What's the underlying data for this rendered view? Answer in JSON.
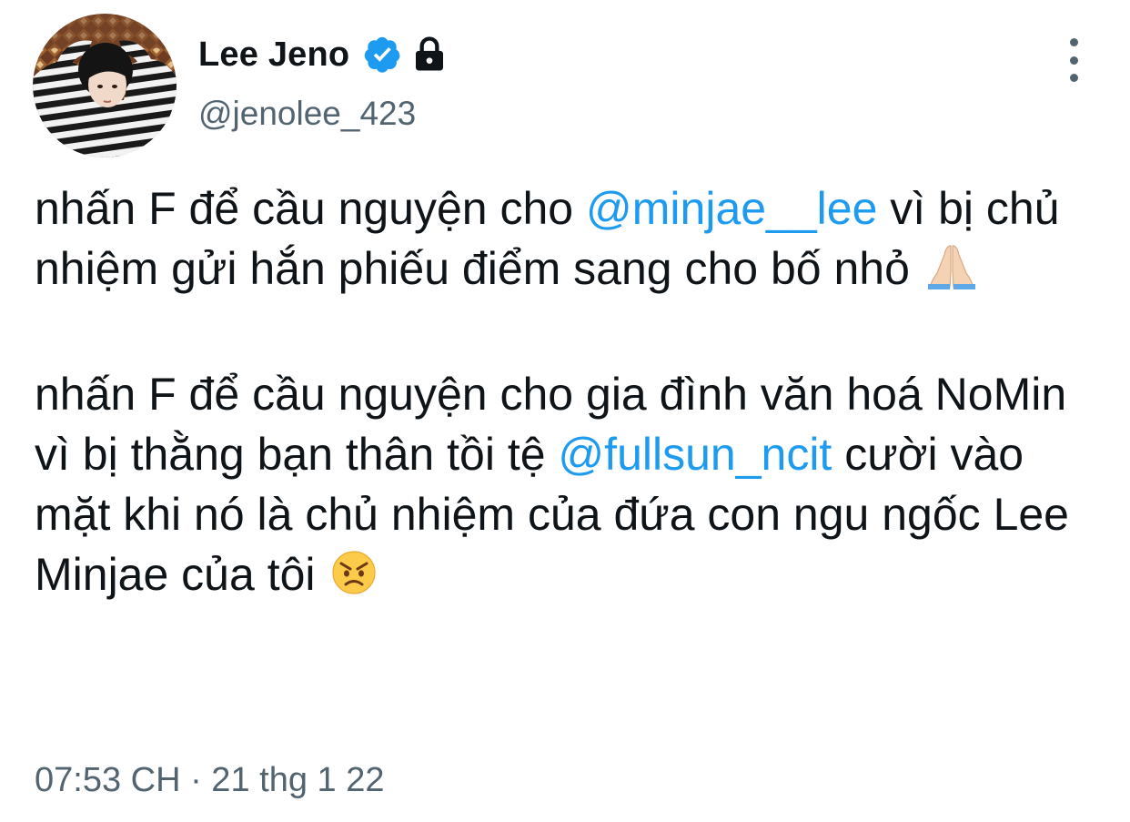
{
  "author": {
    "display_name": "Lee Jeno",
    "handle": "@jenolee_423",
    "verified": true,
    "protected": true
  },
  "icons": {
    "avatar": "profile-photo",
    "verified": "verified-badge-icon",
    "lock": "lock-icon",
    "more": "more-vertical-icon",
    "emoji_1": "folded-hands-emoji",
    "emoji_2": "angry-face-emoji"
  },
  "tweet": {
    "p1": {
      "t1": "nhấn F để cầu nguyện cho ",
      "mention": "@minjae__lee",
      "t2": " vì bị chủ nhiệm gửi hắn phiếu điểm sang cho bố nhỏ "
    },
    "p2": {
      "t1": "nhấn F để cầu nguyện cho gia đình văn hoá NoMin vì bị thằng bạn thân tồi tệ ",
      "mention": "@fullsun_ncit",
      "t2": " cười vào mặt khi nó là chủ nhiệm của đứa con ngu ngốc Lee Minjae của tôi "
    }
  },
  "timestamp": "07:53 CH · 21 thg 1 22",
  "colors": {
    "mention": "#1d9bf0",
    "verified": "#1d9bf0",
    "secondary_text": "#536471",
    "primary_text": "#0f1419"
  }
}
